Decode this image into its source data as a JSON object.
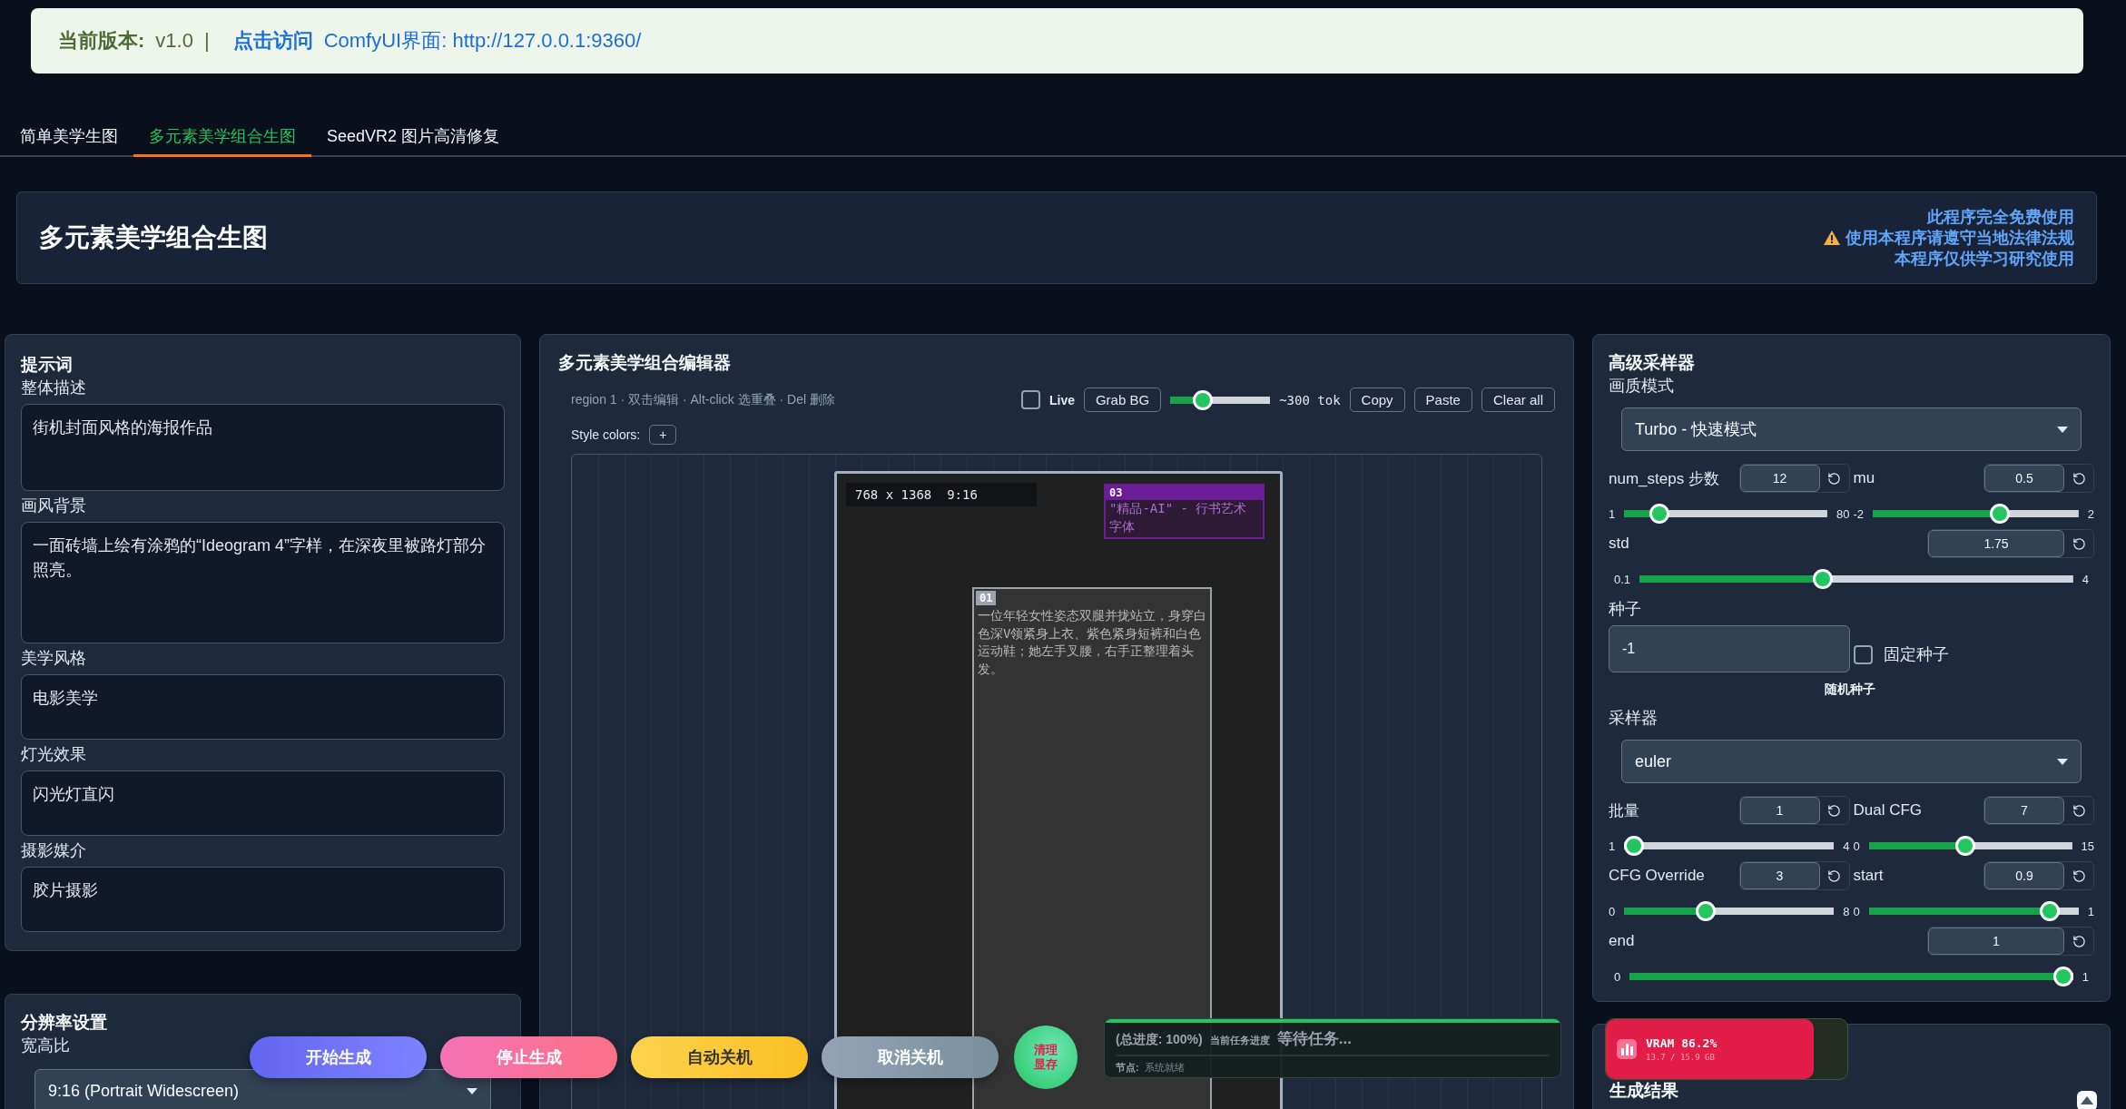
{
  "banner": {
    "version_label": "当前版本:",
    "version": "v1.0",
    "separator": "|",
    "link_prefix": "点击访问",
    "link_text": "ComfyUI界面: http://127.0.0.1:9360/"
  },
  "tabs": [
    {
      "label": "简单美学生图",
      "selected": false
    },
    {
      "label": "多元素美学组合生图",
      "selected": true
    },
    {
      "label": "SeedVR2 图片高清修复",
      "selected": false
    }
  ],
  "title": "多元素美学组合生图",
  "notice": [
    {
      "text": "此程序完全免费使用",
      "warning": false
    },
    {
      "text": "使用本程序请遵守当地法律法规",
      "warning": true
    },
    {
      "text": "本程序仅供学习研究使用",
      "warning": false
    }
  ],
  "prompt_panel": {
    "title": "提示词",
    "fields": [
      {
        "label": "整体描述",
        "value": "街机封面风格的海报作品"
      },
      {
        "label": "画风背景",
        "value": "一面砖墙上绘有涂鸦的“Ideogram 4”字样，在深夜里被路灯部分照亮。"
      },
      {
        "label": "美学风格",
        "value": "电影美学"
      },
      {
        "label": "灯光效果",
        "value": "闪光灯直闪"
      },
      {
        "label": "摄影媒介",
        "value": "胶片摄影"
      }
    ]
  },
  "resolution_panel": {
    "title": "分辨率设置",
    "aspect_label": "宽高比",
    "aspect_value": "9:16 (Portrait Widescreen)"
  },
  "editor": {
    "title": "多元素美学组合编辑器",
    "hint": "region 1 · 双击编辑 · Alt-click 选重叠 · Del 删除",
    "live": {
      "label": "Live",
      "checked": false
    },
    "grab_bg": "Grab BG",
    "token_slider": {
      "level": 0.28
    },
    "token_estimate": "~300 tok",
    "buttons": [
      "Copy",
      "Paste",
      "Clear all"
    ],
    "style_colors_label": "Style colors:",
    "add_color": "+",
    "canvas": {
      "info": "768 x 1368  9:16",
      "regions": [
        {
          "tag": "03",
          "text": "\"精品-AI\" - 行书艺术字体",
          "color": "#6b1d96"
        },
        {
          "tag": "01",
          "text": "一位年轻女性姿态双腿并拢站立，身穿白色深V领紧身上衣、紫色紧身短裤和白色运动鞋；她左手叉腰，右手正整理着头发。",
          "color": "#9ca3af"
        }
      ]
    }
  },
  "sampler": {
    "title": "高级采样器",
    "quality_label": "画质模式",
    "quality_value": "Turbo - 快速模式",
    "params1": [
      {
        "kind": "half",
        "label": "num_steps 步数",
        "value": "12",
        "min": "1",
        "max": "80",
        "level": 0.14
      },
      {
        "kind": "half",
        "label": "mu",
        "value": "0.5",
        "min": "-2",
        "max": "2",
        "level": 0.63
      },
      {
        "kind": "full",
        "label": "std",
        "value": "1.75",
        "min": "0.1",
        "max": "4",
        "level": 0.42
      }
    ],
    "seed_label": "种子",
    "fixed_seed": {
      "label": "固定种子",
      "checked": false
    },
    "seed_value": "-1",
    "random_seed": "随机种子",
    "sampler_label": "采样器",
    "sampler_value": "euler",
    "params2": [
      {
        "kind": "half",
        "label": "批量",
        "value": "1",
        "min": "1",
        "max": "4",
        "level": 0
      },
      {
        "kind": "half",
        "label": "Dual CFG",
        "value": "7",
        "min": "0",
        "max": "15",
        "level": 0.47
      },
      {
        "kind": "half",
        "label": "CFG Override",
        "value": "3",
        "min": "0",
        "max": "8",
        "level": 0.375
      },
      {
        "kind": "half",
        "label": "start",
        "value": "0.9",
        "min": "0",
        "max": "1",
        "level": 0.9
      },
      {
        "kind": "full",
        "label": "end",
        "value": "1",
        "min": "0",
        "max": "1",
        "level": 1
      }
    ]
  },
  "results": {
    "title": "生成结果"
  },
  "vram": {
    "label": "VRAM 86.2%",
    "detail": "13.7 / 15.9 GB",
    "level": 0.862
  },
  "actions": [
    {
      "label": "开始生成",
      "kind": "start"
    },
    {
      "label": "停止生成",
      "kind": "stop"
    },
    {
      "label": "自动关机",
      "kind": "shutdown"
    },
    {
      "label": "取消关机",
      "kind": "cancel"
    }
  ],
  "clear_vram": "清理显存",
  "progress": {
    "total": "(总进度: 100%)",
    "current_label": "当前任务进度",
    "status": "等待任务...",
    "node_label": "节点:",
    "node_value": "系统就绪",
    "level": 1
  }
}
